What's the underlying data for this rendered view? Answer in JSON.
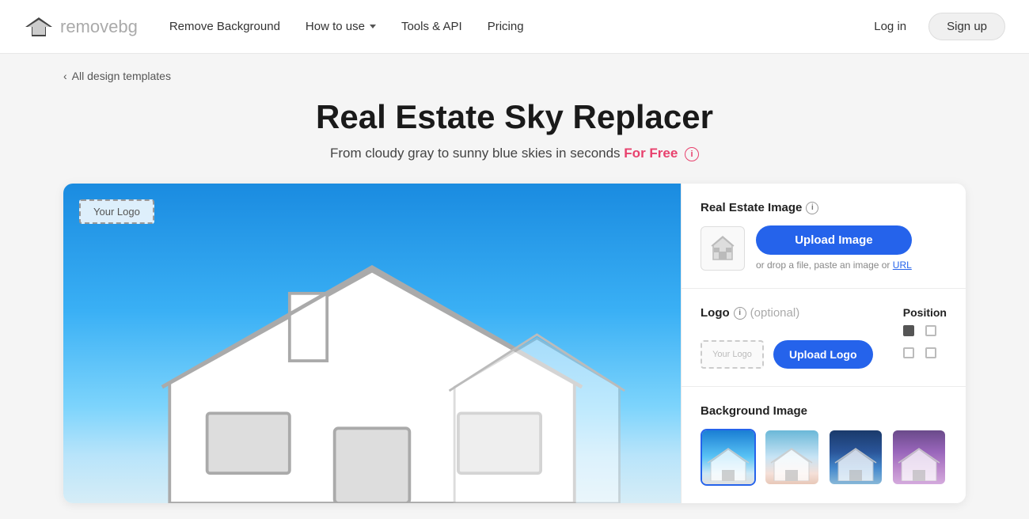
{
  "brand": {
    "name_dark": "remove",
    "name_light": "bg",
    "logo_alt": "removebg logo"
  },
  "navbar": {
    "remove_background_label": "Remove Background",
    "how_to_use_label": "How to use",
    "tools_api_label": "Tools & API",
    "pricing_label": "Pricing",
    "login_label": "Log in",
    "signup_label": "Sign up"
  },
  "breadcrumb": {
    "back_label": "All design templates"
  },
  "page": {
    "title": "Real Estate Sky Replacer",
    "subtitle": "From cloudy gray to sunny blue skies in seconds",
    "for_free_label": "For Free",
    "info_icon_label": "i"
  },
  "settings": {
    "real_estate_image_label": "Real Estate Image",
    "upload_image_label": "Upload Image",
    "drop_hint": "or drop a file, paste an image or",
    "url_label": "URL",
    "logo_label": "Logo",
    "optional_label": "(optional)",
    "position_label": "Position",
    "upload_logo_label": "Upload Logo",
    "logo_placeholder_text": "Your Logo",
    "background_image_label": "Background Image"
  },
  "preview": {
    "your_logo_text": "Your Logo"
  },
  "bg_images": [
    {
      "id": "bg1",
      "style": "blue-clear"
    },
    {
      "id": "bg2",
      "style": "light-clouds"
    },
    {
      "id": "bg3",
      "style": "dark-blue"
    },
    {
      "id": "bg4",
      "style": "purple-dusk"
    }
  ]
}
